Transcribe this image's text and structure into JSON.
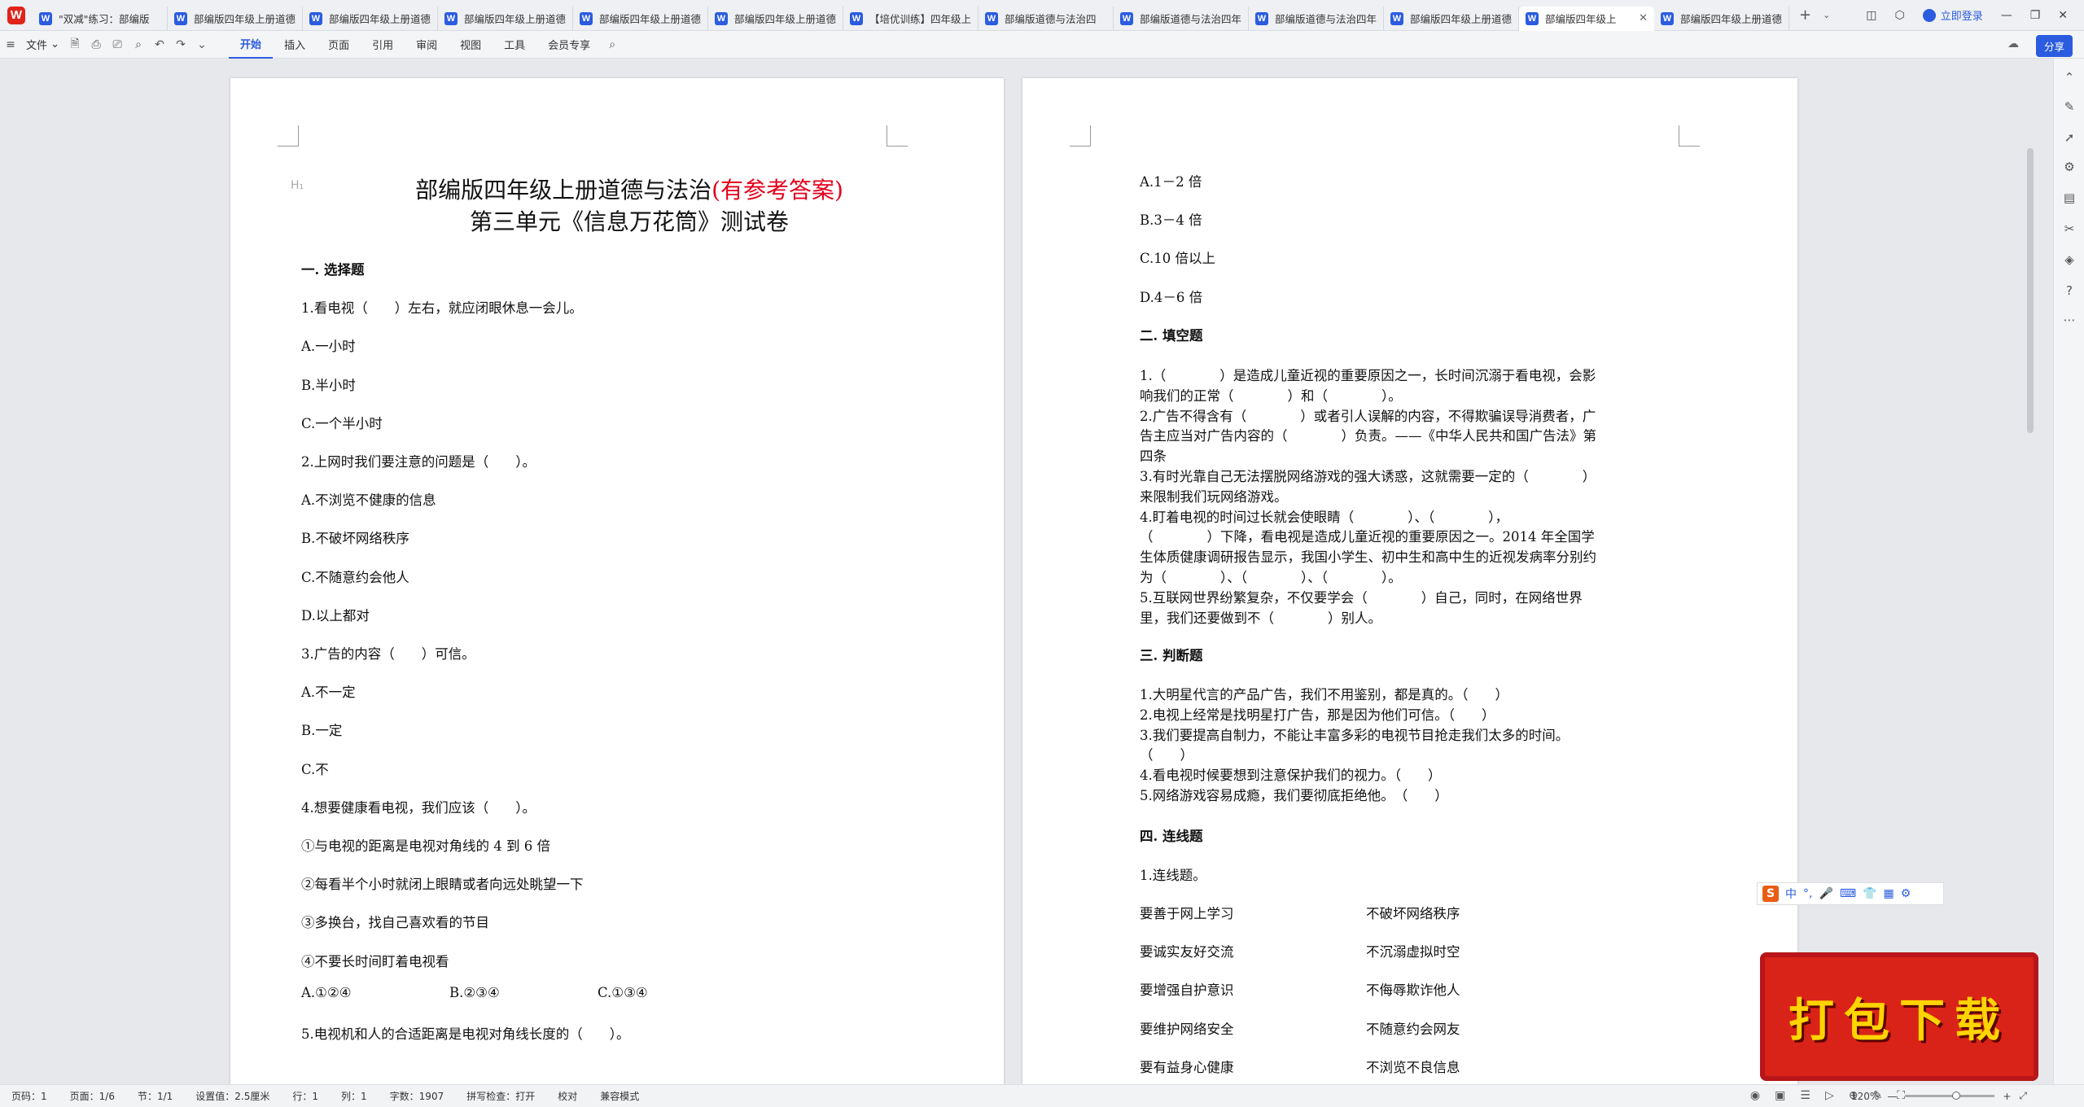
{
  "tabs": [
    {
      "label": "\"双减\"练习：部编版",
      "active": false
    },
    {
      "label": "部编版四年级上册道德",
      "active": false
    },
    {
      "label": "部编版四年级上册道德",
      "active": false
    },
    {
      "label": "部编版四年级上册道德",
      "active": false
    },
    {
      "label": "部编版四年级上册道德",
      "active": false
    },
    {
      "label": "部编版四年级上册道德",
      "active": false
    },
    {
      "label": "【培优训练】四年级上",
      "active": false
    },
    {
      "label": "部编版道德与法治四",
      "active": false
    },
    {
      "label": "部编版道德与法治四年",
      "active": false
    },
    {
      "label": "部编版道德与法治四年",
      "active": false
    },
    {
      "label": "部编版四年级上册道德",
      "active": false
    },
    {
      "label": "部编版四年级上",
      "active": true
    },
    {
      "label": "部编版四年级上册道德",
      "active": false
    }
  ],
  "titlebar": {
    "login": "立即登录"
  },
  "menu": {
    "file": "文件",
    "items": [
      "开始",
      "插入",
      "页面",
      "引用",
      "审阅",
      "视图",
      "工具",
      "会员专享"
    ],
    "share": "分享"
  },
  "page1": {
    "title_main": "部编版四年级上册道德与法治",
    "title_red": "(有参考答案)",
    "subtitle": "第三单元《信息万花筒》测试卷",
    "h": "H₁",
    "lines": [
      "一. 选择题",
      "1.看电视（　　）左右，就应闭眼休息一会儿。",
      "A.一小时",
      "B.半小时",
      "C.一个半小时",
      "2.上网时我们要注意的问题是（　　）。",
      "A.不浏览不健康的信息",
      "B.不破坏网络秩序",
      "C.不随意约会他人",
      "D.以上都对",
      "3.广告的内容（　　）可信。",
      "A.不一定",
      "B.一定",
      "C.不",
      "4.想要健康看电视，我们应该（　　）。",
      "①与电视的距离是电视对角线的 4 到 6 倍",
      "②每看半个小时就闭上眼睛或者向远处眺望一下",
      "③多换台，找自己喜欢看的节目",
      "④不要长时间盯着电视看",
      "5.电视机和人的合适距离是电视对角线长度的（　　）。"
    ],
    "q4_options": [
      "A.①②④",
      "B.②③④",
      "C.①③④"
    ]
  },
  "page2": {
    "lines_a": [
      "A.1－2 倍",
      "B.3－4 倍",
      "C.10 倍以上",
      "D.4－6 倍",
      "二. 填空题"
    ],
    "fill": [
      "1.（　　　　）是造成儿童近视的重要原因之一，长时间沉溺于看电视，会影",
      "响我们的正常（　　　　）和（　　　　）。",
      "2.广告不得含有（　　　　）或者引人误解的内容，不得欺骗误导消费者，广",
      "告主应当对广告内容的（　　　　）负责。——《中华人民共和国广告法》第",
      "四条",
      "3.有时光靠自己无法摆脱网络游戏的强大诱惑，这就需要一定的（　　　　）",
      "来限制我们玩网络游戏。",
      "4.盯着电视的时间过长就会使眼睛（　　　　）、（　　　　），",
      "（　　　　）下降，看电视是造成儿童近视的重要原因之一。2014 年全国学",
      "生体质健康调研报告显示，我国小学生、初中生和高中生的近视发病率分别约",
      "为（　　　　）、（　　　　）、（　　　　）。",
      "5.互联网世界纷繁复杂，不仅要学会（　　　　）自己，同时，在网络世界",
      "里，我们还要做到不（　　　　）别人。"
    ],
    "judge_title": "三. 判断题",
    "judge": [
      "1.大明星代言的产品广告，我们不用鉴别，都是真的。（　　）",
      "2.电视上经常是找明星打广告，那是因为他们可信。（　　）",
      "3.我们要提高自制力，不能让丰富多彩的电视节目抢走我们太多的时间。",
      "（　　）",
      "4.看电视时候要想到注意保护我们的视力。（　　）",
      "5.网络游戏容易成瘾，我们要彻底拒绝他。　（　　）"
    ],
    "link_title": "四. 连线题",
    "link_q": "1.连线题。",
    "link_left": [
      "要善于网上学习",
      "要诚实友好交流",
      "要增强自护意识",
      "要维护网络安全",
      "要有益身心健康"
    ],
    "link_right": [
      "不破坏网络秩序",
      "不沉溺虚拟时空",
      "不侮辱欺诈他人",
      "不随意约会网友",
      "不浏览不良信息"
    ]
  },
  "ime": {
    "label": "中"
  },
  "download": {
    "label": "打包下载"
  },
  "status": {
    "page": "页码：1",
    "pages": "页面：1/6",
    "section": "节：1/1",
    "setting": "设置值：2.5厘米",
    "row": "行：1",
    "col": "列：1",
    "words": "字数：1907",
    "spell": "拼写检查：打开",
    "proof": "校对",
    "compat": "兼容模式",
    "zoom": "120%"
  }
}
